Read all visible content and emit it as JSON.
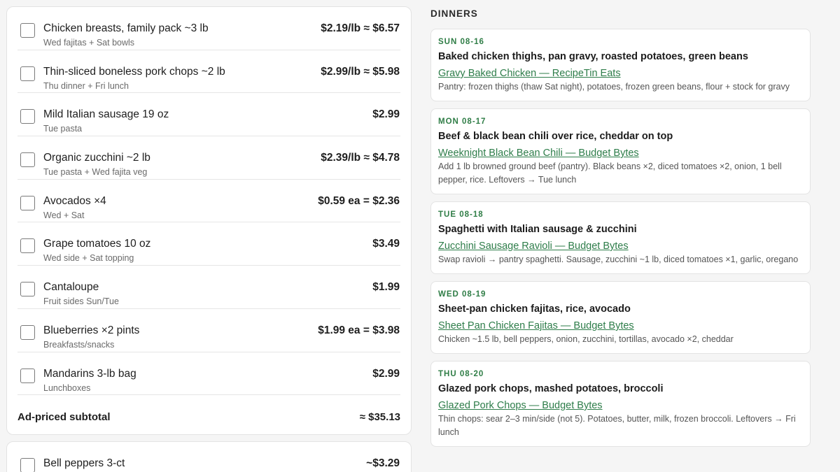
{
  "shopping_list": {
    "items": [
      {
        "name": "Chicken breasts, family pack ~3 lb",
        "note": "Wed fajitas + Sat bowls",
        "price": "$2.19/lb ≈ $6.57"
      },
      {
        "name": "Thin-sliced boneless pork chops ~2 lb",
        "note": "Thu dinner + Fri lunch",
        "price": "$2.99/lb ≈ $5.98"
      },
      {
        "name": "Mild Italian sausage 19 oz",
        "note": "Tue pasta",
        "price": "$2.99"
      },
      {
        "name": "Organic zucchini ~2 lb",
        "note": "Tue pasta + Wed fajita veg",
        "price": "$2.39/lb ≈ $4.78"
      },
      {
        "name": "Avocados ×4",
        "note": "Wed + Sat",
        "price": "$0.59 ea = $2.36"
      },
      {
        "name": "Grape tomatoes 10 oz",
        "note": "Wed side + Sat topping",
        "price": "$3.49"
      },
      {
        "name": "Cantaloupe",
        "note": "Fruit sides Sun/Tue",
        "price": "$1.99"
      },
      {
        "name": "Blueberries ×2 pints",
        "note": "Breakfasts/snacks",
        "price": "$1.99 ea = $3.98"
      },
      {
        "name": "Mandarins 3-lb bag",
        "note": "Lunchboxes",
        "price": "$2.99"
      }
    ],
    "subtotal_label": "Ad-priced subtotal",
    "subtotal_value": "≈ $35.13"
  },
  "second_list": {
    "items": [
      {
        "name": "Bell peppers 3-ct",
        "price": "~$3.29"
      }
    ]
  },
  "dinners": {
    "section_title": "DINNERS",
    "entries": [
      {
        "date": "SUN 08-16",
        "title": "Baked chicken thighs, pan gravy, roasted potatoes, green beans",
        "link": "Gravy Baked Chicken — RecipeTin Eats",
        "desc": "Pantry: frozen thighs (thaw Sat night), potatoes, frozen green beans, flour + stock for gravy"
      },
      {
        "date": "MON 08-17",
        "title": "Beef & black bean chili over rice, cheddar on top",
        "link": "Weeknight Black Bean Chili — Budget Bytes",
        "desc": "Add 1 lb browned ground beef (pantry). Black beans ×2, diced tomatoes ×2, onion, 1 bell pepper, rice. Leftovers → Tue lunch"
      },
      {
        "date": "TUE 08-18",
        "title": "Spaghetti with Italian sausage & zucchini",
        "link": "Zucchini Sausage Ravioli — Budget Bytes",
        "desc": "Swap ravioli → pantry spaghetti. Sausage, zucchini ~1 lb, diced tomatoes ×1, garlic, oregano"
      },
      {
        "date": "WED 08-19",
        "title": "Sheet-pan chicken fajitas, rice, avocado",
        "link": "Sheet Pan Chicken Fajitas — Budget Bytes",
        "desc": "Chicken ~1.5 lb, bell peppers, onion, zucchini, tortillas, avocado ×2, cheddar"
      },
      {
        "date": "THU 08-20",
        "title": "Glazed pork chops, mashed potatoes, broccoli",
        "link": "Glazed Pork Chops — Budget Bytes",
        "desc": "Thin chops: sear 2–3 min/side (not 5). Potatoes, butter, milk, frozen broccoli. Leftovers → Fri lunch"
      }
    ]
  },
  "colors": {
    "accent_green": "#2f7d46",
    "background": "#f5f5f5",
    "card": "#ffffff"
  }
}
